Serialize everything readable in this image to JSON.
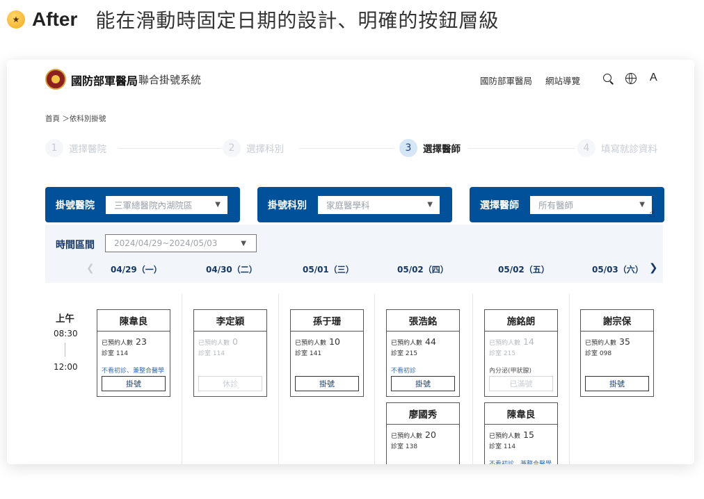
{
  "heading": {
    "emoji": "🤩",
    "after": "After",
    "text": "能在滑動時固定日期的設計、明確的按鈕層級"
  },
  "header": {
    "brand": "國防部軍醫局",
    "subtitle": "聯合掛號系統",
    "nav": [
      "國防部軍醫局",
      "網站導覽"
    ],
    "icons": [
      "search-icon",
      "globe-icon",
      "font-size-icon"
    ],
    "font_size_label": "A"
  },
  "breadcrumb": "首頁 ＞依科別掛號",
  "steps": [
    {
      "num": "1",
      "label": "選擇醫院"
    },
    {
      "num": "2",
      "label": "選擇科別"
    },
    {
      "num": "3",
      "label": "選擇醫師",
      "active": true
    },
    {
      "num": "4",
      "label": "填寫就診資料"
    }
  ],
  "filters": [
    {
      "label": "掛號醫院",
      "value": "三軍總醫院內湖院區"
    },
    {
      "label": "掛號科別",
      "value": "家庭醫學科"
    },
    {
      "label": "選擇醫師",
      "value": "所有醫師"
    }
  ],
  "time_range": {
    "label": "時間區間",
    "value": "2024/04/29~2024/05/03"
  },
  "dates": [
    "04/29（一）",
    "04/30（二）",
    "05/01（三）",
    "05/02（四）",
    "05/02（五）",
    "05/03（六）"
  ],
  "session": {
    "label": "上午",
    "start": "08:30",
    "end": "12:00"
  },
  "doctors": [
    {
      "name": "陳韋良",
      "booked_label": "已預約人數",
      "booked": "23",
      "room": "診室 114",
      "note": "不看初診、兼整合醫學",
      "button": "掛號",
      "state": "open"
    },
    {
      "name": "李定穎",
      "booked_label": "已預約人數",
      "booked": "0",
      "room": "診室 114",
      "note": "",
      "button": "休診",
      "state": "closed"
    },
    {
      "name": "孫于珊",
      "booked_label": "已預約人數",
      "booked": "10",
      "room": "診室 141",
      "note": "",
      "button": "掛號",
      "state": "open"
    },
    {
      "name": "張浩銘",
      "booked_label": "已預約人數",
      "booked": "44",
      "room": "診室 215",
      "note": "不看初診",
      "button": "掛號",
      "state": "open"
    },
    {
      "name": "施銘朗",
      "booked_label": "已預約人數",
      "booked": "14",
      "room": "診室 215",
      "note": "內分泌(甲狀腺)",
      "button": "已滿號",
      "state": "full"
    },
    {
      "name": "謝宗保",
      "booked_label": "已預約人數",
      "booked": "35",
      "room": "診室 098",
      "note": "",
      "button": "掛號",
      "state": "open"
    },
    {
      "name": "廖國秀",
      "booked_label": "已預約人數",
      "booked": "20",
      "room": "診室 138",
      "note": "",
      "button": "",
      "state": "open"
    },
    {
      "name": "陳韋良",
      "booked_label": "已預約人數",
      "booked": "15",
      "room": "診室 114",
      "note": "不看初診、兼整合醫學",
      "button": "",
      "state": "open"
    }
  ]
}
